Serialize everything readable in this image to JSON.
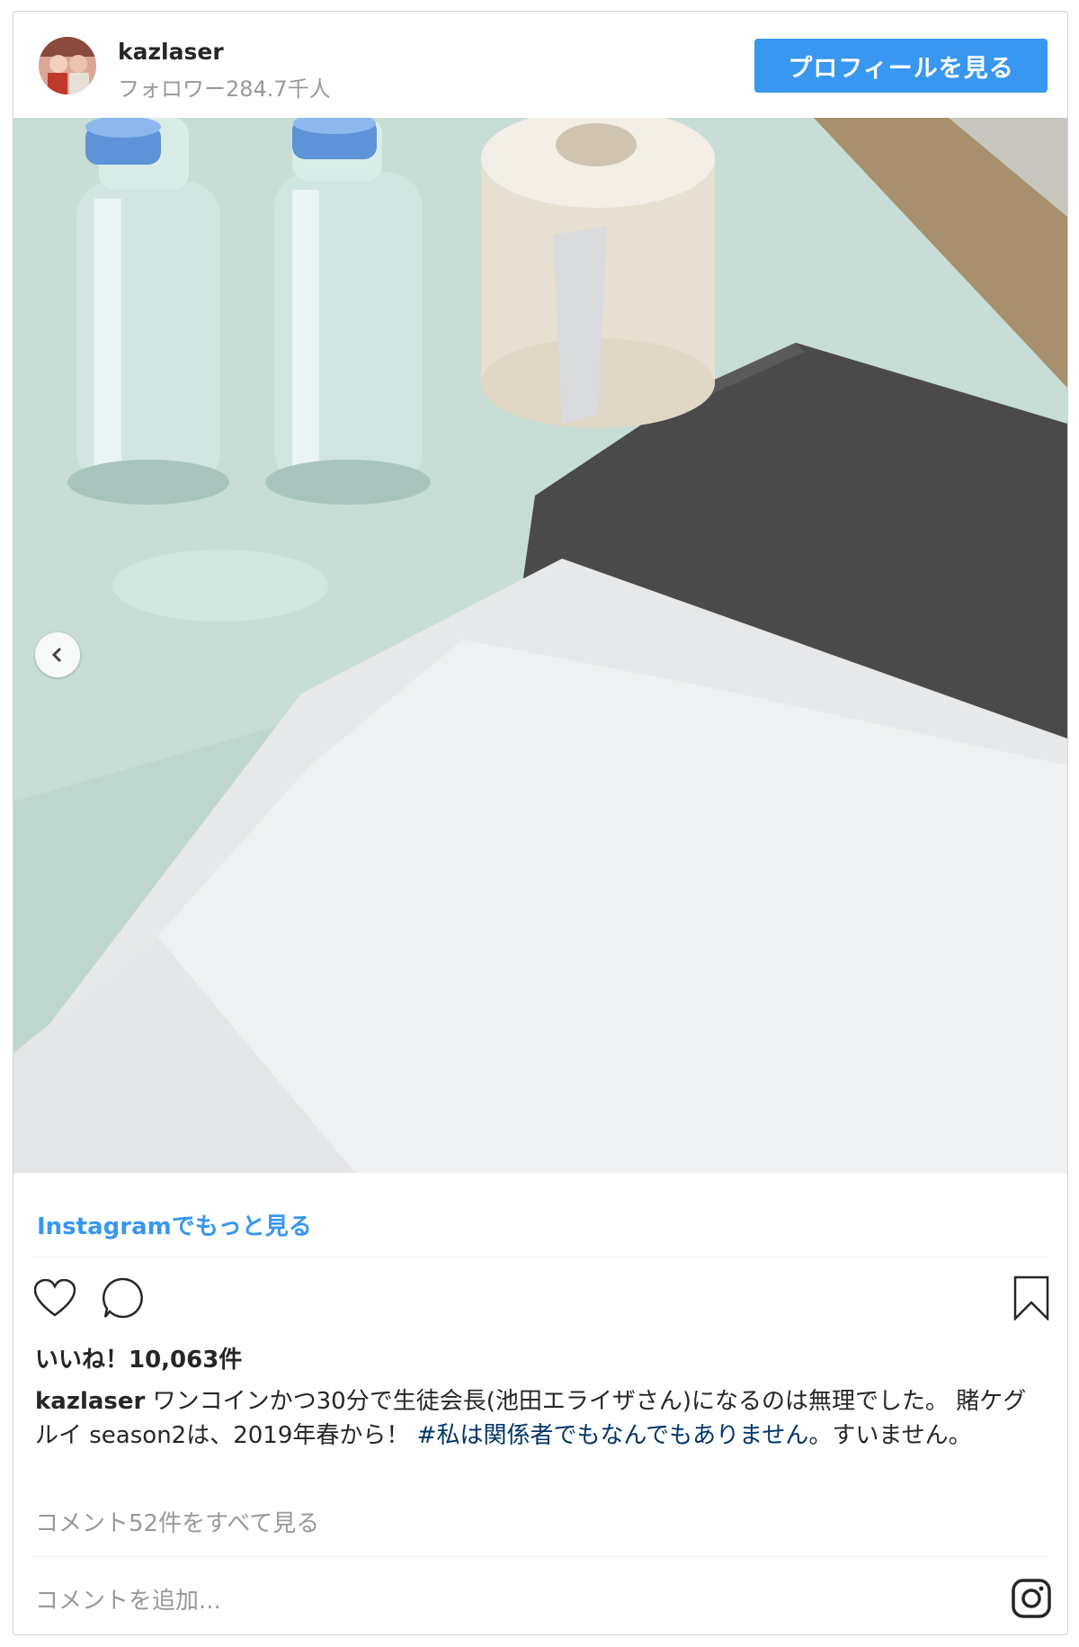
{
  "header": {
    "username": "kazlaser",
    "followers": "フォロワー284.7千人",
    "profile_button": "プロフィールを見る"
  },
  "photo": {
    "description_icon": "previous-arrow-icon"
  },
  "more_link": "Instagramでもっと見る",
  "actions": {
    "like_icon": "heart-icon",
    "comment_icon": "comment-icon",
    "save_icon": "bookmark-icon"
  },
  "likes": "いいね！10,063件",
  "caption": {
    "user": "kazlaser",
    "text_line": " ワンコインかつ30分で生徒会長(池田エライザさん)になるのは無理でした。 賭ケグルイ season2は、2019年春から！ ",
    "hashtag": "#私は関係者でもなんでもありません",
    "tail": "。すいません。"
  },
  "view_comments": "コメント52件をすべて見る",
  "comment_placeholder": "コメントを追加...",
  "footer_icon": "instagram-icon",
  "colors": {
    "accent": "#3897f0",
    "hashtag": "#003569",
    "muted": "#999999"
  }
}
